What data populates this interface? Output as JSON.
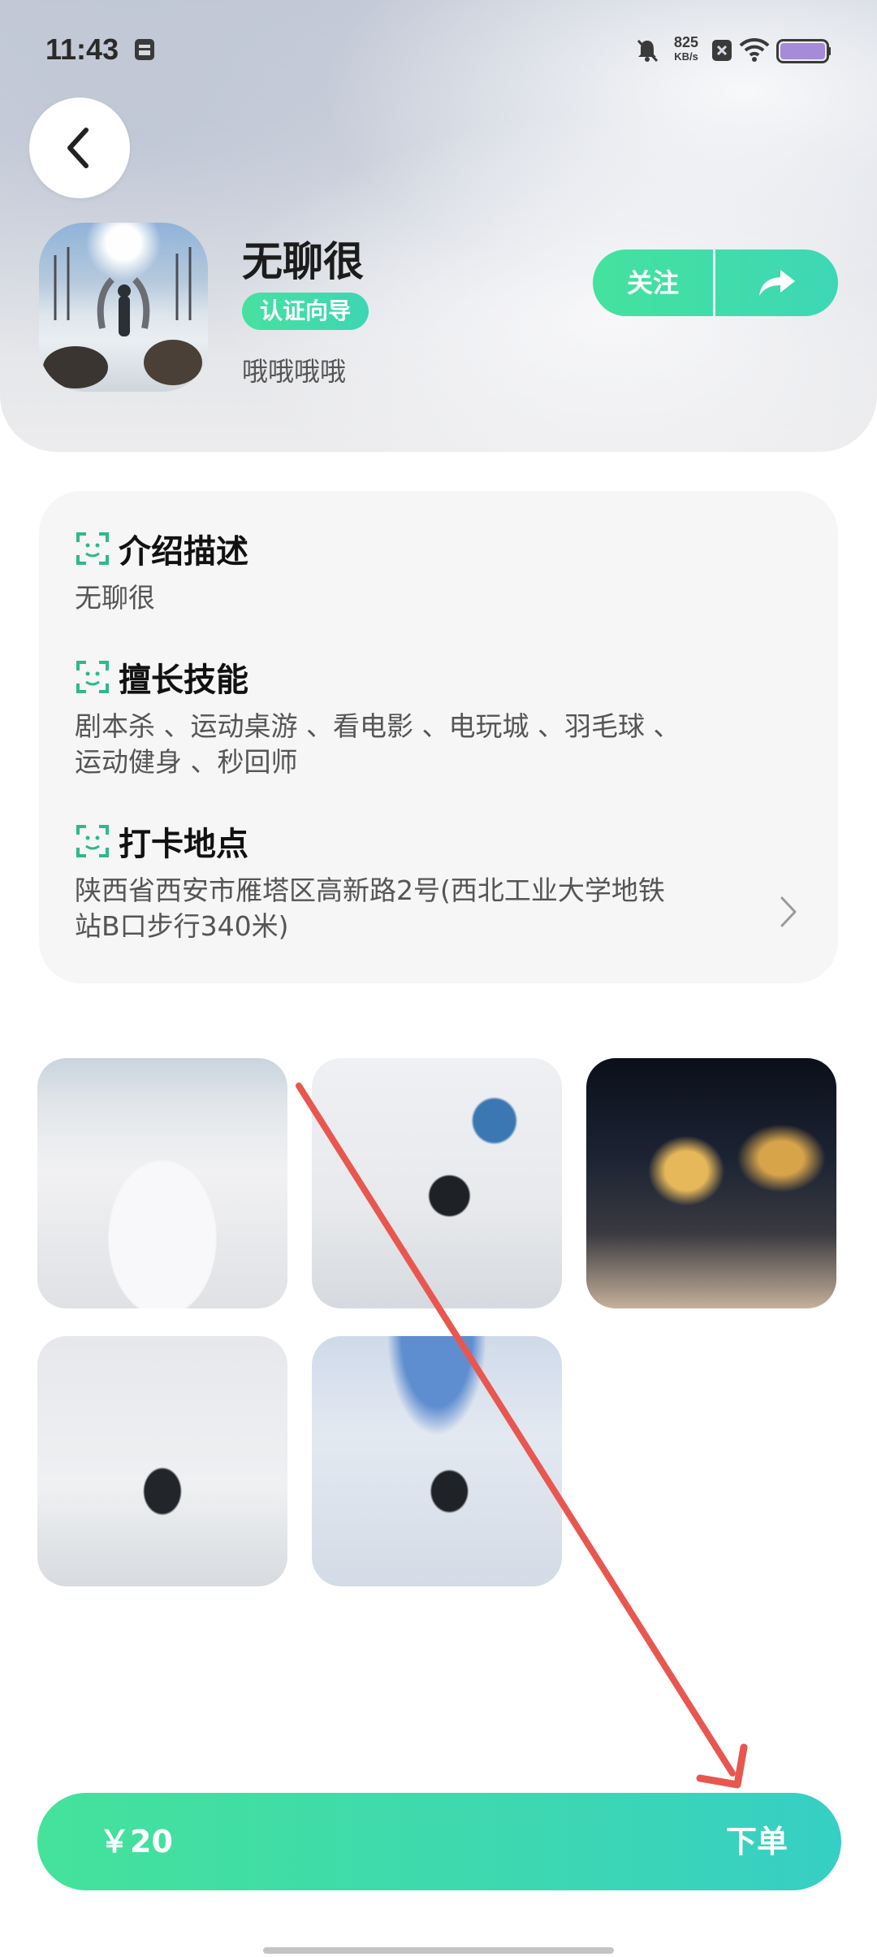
{
  "status_bar": {
    "time": "11:43",
    "net_speed_value": "825",
    "net_speed_unit": "KB/s",
    "icons": [
      "notification-icon",
      "mute-bell-icon",
      "sim-x-icon",
      "wifi-icon",
      "battery-icon"
    ]
  },
  "profile": {
    "name": "无聊很",
    "badge": "认证向导",
    "signature": "哦哦哦哦",
    "follow_label": "关注"
  },
  "sections": [
    {
      "title": "介绍描述",
      "text": "无聊很"
    },
    {
      "title": "擅长技能",
      "line1": "剧本杀 、运动桌游 、看电影 、电玩城 、羽毛球 、",
      "line2": "运动健身 、秒回师"
    },
    {
      "title": "打卡地点",
      "line1": "陕西省西安市雁塔区高新路2号(西北工业大学地铁",
      "line2": "站B口步行340米)"
    }
  ],
  "order": {
    "price": "￥20",
    "button_label": "下单"
  },
  "colors": {
    "accent_start": "#44e29b",
    "accent_end": "#36cfc4",
    "annotation_arrow": "#e8574f"
  }
}
